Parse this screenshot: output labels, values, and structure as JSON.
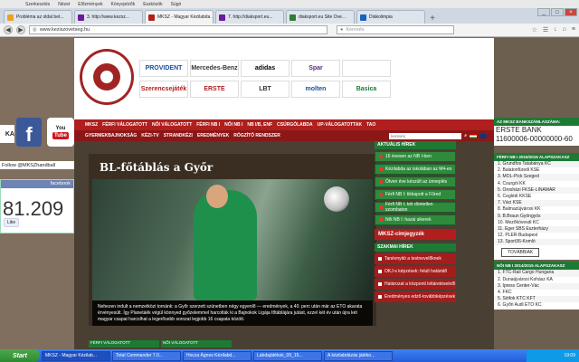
{
  "browser": {
    "menu": [
      "Szerkesztés",
      "Nézet",
      "Előzmények",
      "Könyvjelzők",
      "Eszközök",
      "Súgó"
    ],
    "tabs": [
      {
        "label": "Problémа az oldal bet...",
        "color": "#f0a020",
        "active": false
      },
      {
        "label": "3. http://www.kezsz...",
        "color": "#6a1b9a",
        "active": false
      },
      {
        "label": "MKSZ - Magyar Kézilabda ...",
        "color": "#b01e1e",
        "active": true
      },
      {
        "label": "7. http://diaksport.eu...",
        "color": "#6a1b9a",
        "active": false
      },
      {
        "label": "diaksport.eu Site Ove...",
        "color": "#2e7d32",
        "active": false
      },
      {
        "label": "Diákolimpia",
        "color": "#1565c0",
        "active": false
      }
    ],
    "newtab": "+",
    "window_buttons": [
      "_",
      "□",
      "×"
    ],
    "url": "www.keziszovetseg.hu",
    "search_placeholder": "Keresés"
  },
  "left": {
    "ka_stub": "KA",
    "facebook_glyph": "f",
    "youtube_you": "You",
    "youtube_tube": "Tube",
    "follow": "Follow @MKSZhandball",
    "fb_header": "facebook",
    "fb_count": "81.209",
    "fb_like": "Like"
  },
  "header": {
    "logo_text": "MAGYAR KÉZILABDA SZÖVETSÉG",
    "sponsors": [
      "PROVIDENT",
      "Mercedes-Benz",
      "adidas",
      "Spar",
      "",
      "Szerencsejáték",
      "ERSTE",
      "LBT",
      "molten",
      "Basica"
    ]
  },
  "main_nav": [
    "MKSZ",
    "FÉRFI VÁLOGATOTT",
    "NŐI VÁLOGATOTT",
    "FÉRFI NB I",
    "NŐI NB I",
    "NB I/B, ENF",
    "CSÚRGÓLABDA",
    "UP-VÁLOGATOTTAK",
    "TAO"
  ],
  "sub_nav": [
    "GYERMEKBAJNOKSÁG",
    "KÉZI-TV",
    "STRANDKÉZI",
    "EREDMÉNYEK",
    "RÖGZÍTŐ RENDSZER"
  ],
  "site_search": {
    "placeholder": "keresés"
  },
  "article": {
    "title": "BL-főtáblás a Győr",
    "caption": "Nehezen indult a nemzetközi tornánk: a Győr szerzett szünetben négy egyenlő — eredmények, a 40. perc után már az ETO akarata érvényesült. Így Planetáék végül könnyed győzelemmel harcolták ki a Bajnokok Ligája főtáblájára jutást, ezzel két év után újra két magyar csapat harcolhat a legerősebb sorozat legjobb 16 csapata között."
  },
  "bottom_labels": [
    "FÉRFI VÁLOGATOTT",
    "NŐI VÁLOGATOTT"
  ],
  "aktualis": {
    "header": "AKTUÁLIS HÍREK",
    "items": [
      "16 évesen az NB I-ben",
      "Kézilabda az iskolában az M4-en",
      "Ötven éve készült az ünneplés",
      "Férfi NB I: tikkapott a Fűred",
      "Férfi NB I: két döntetlen szombaton",
      "Női NB I: hazai sikerek"
    ]
  },
  "cimjegyzek": "MKSZ-címjegyzék",
  "szakmai": {
    "header": "SZAKMAI HÍREK",
    "items": [
      "Tanévnyitó a testnevelőknek",
      "OKJ-s képzések: felult határidő",
      "Határozat a központi leltáretésekről",
      "Eredményes edző-továbbképzések"
    ]
  },
  "right": {
    "bank_header": "AZ MKSZ BANKSZÁMLASZÁMA:",
    "bank_name": "ERSTE BANK",
    "bank_number": "11600006-00000000-60",
    "mens_header": "FÉRFI NB I 2015/2016 ALAPSZAKASZ",
    "mens": [
      "1. Grundfos Tatabánya KC",
      "2. Balatonfüredi KSE",
      "3. MOL-Pick Szeged",
      "4. Csurgói KK",
      "5. Orosházi FKSE-LINAMAR",
      "6. Ceglédi KKSE",
      "7. Váci KSE",
      "8. Balmazújvárosi KK",
      "9. B.Braun Gyöngyös",
      "10. Mezőkövesdi KC",
      "11. Eger SBS Eszterházy",
      "12. PLER-Budapest",
      "13. Sport36-Komló"
    ],
    "more": "TOVÁBBIAK",
    "womens_header": "NŐI NB I 2014/2015 ALAPSZAKASZ",
    "womens": [
      "1. FTC-Rail Cargo Hungaria",
      "2. Dunaújvárosi Kohász KA",
      "3. Ipress Center-Vác",
      "4. FKC",
      "5. Siófok KTC KFT",
      "6. Győri Audi ETO KC"
    ]
  },
  "taskbar": {
    "start": "Start",
    "tasks": [
      "MKSZ - Magyar Kézilab...",
      "Total Commander 7.0...",
      "Hocza Ágnes Kézilabd...",
      "Labdajátékok_09_15...",
      "A kézilabdázás játéko..."
    ],
    "clock": "19:09"
  }
}
